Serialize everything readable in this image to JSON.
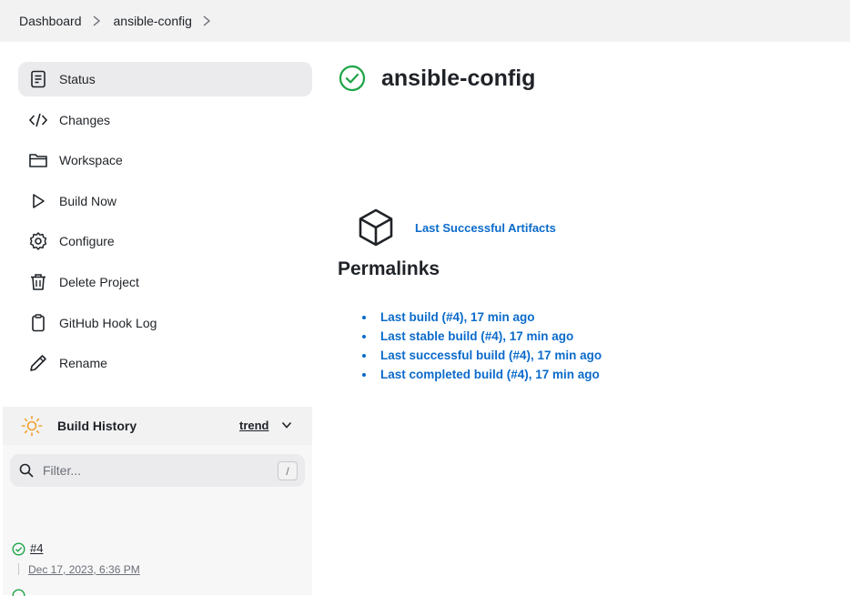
{
  "breadcrumb": {
    "items": [
      "Dashboard",
      "ansible-config"
    ]
  },
  "sidebar": {
    "tasks": [
      {
        "label": "Status",
        "icon": "document-icon",
        "active": true
      },
      {
        "label": "Changes",
        "icon": "code-icon"
      },
      {
        "label": "Workspace",
        "icon": "folder-icon"
      },
      {
        "label": "Build Now",
        "icon": "play-icon"
      },
      {
        "label": "Configure",
        "icon": "gear-icon"
      },
      {
        "label": "Delete Project",
        "icon": "trash-icon"
      },
      {
        "label": "GitHub Hook Log",
        "icon": "clipboard-icon"
      },
      {
        "label": "Rename",
        "icon": "pencil-icon"
      }
    ]
  },
  "build_history": {
    "title": "Build History",
    "trend_label": "trend",
    "filter_placeholder": "Filter...",
    "filter_shortcut": "/",
    "builds": [
      {
        "number": "#4",
        "date": "Dec 17, 2023, 6:36 PM",
        "status": "success"
      }
    ]
  },
  "main": {
    "title": "ansible-config",
    "status": "success",
    "artifacts_label": "Last Successful Artifacts",
    "permalinks_title": "Permalinks",
    "permalinks": [
      "Last build (#4), 17 min ago",
      "Last stable build (#4), 17 min ago",
      "Last successful build (#4), 17 min ago",
      "Last completed build (#4), 17 min ago"
    ]
  },
  "colors": {
    "accent_link": "#0b6bcb",
    "success_green": "#1ea446",
    "sun_orange": "#f0a22b"
  }
}
